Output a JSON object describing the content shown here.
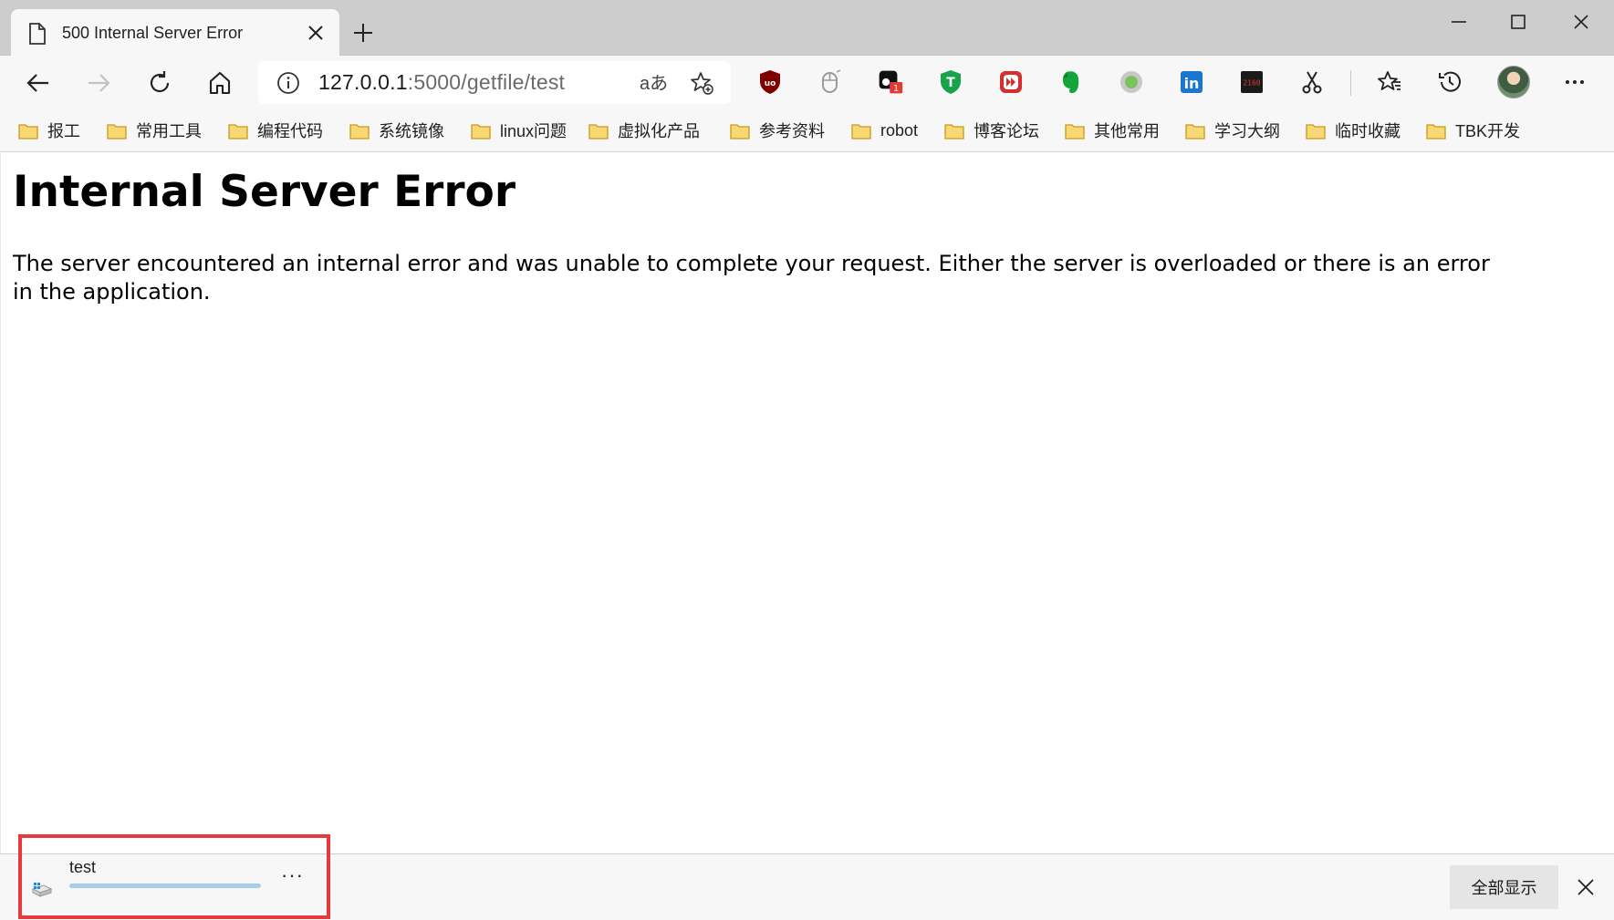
{
  "tab": {
    "title": "500 Internal Server Error",
    "page_icon": "page-icon",
    "close_icon": "close-icon"
  },
  "newtab_icon": "plus-icon",
  "window_controls": [
    "minimize-icon",
    "maximize-icon",
    "close-icon"
  ],
  "toolbar": {
    "back_icon": "back-arrow-icon",
    "forward_icon": "forward-arrow-icon",
    "refresh_icon": "refresh-icon",
    "home_icon": "home-icon",
    "address": {
      "host": "127.0.0.1",
      "path": ":5000/getfile/test",
      "info_icon": "info-icon",
      "translate_label": "aあ",
      "favorite_icon": "add-favorite-icon"
    },
    "extensions": [
      {
        "name": "ublock-icon",
        "label": "uo"
      },
      {
        "name": "mouse-icon",
        "label": ""
      },
      {
        "name": "extension-badge-icon",
        "label": "1"
      },
      {
        "name": "shield-t-icon",
        "label": "T"
      },
      {
        "name": "media-skip-icon",
        "label": ""
      },
      {
        "name": "evernote-icon",
        "label": ""
      },
      {
        "name": "circle-icon",
        "label": ""
      },
      {
        "name": "linkedin-icon",
        "label": "in"
      },
      {
        "name": "counter-icon",
        "label": "2160"
      },
      {
        "name": "scissors-icon",
        "label": ""
      }
    ],
    "favorites_icon": "favorites-icon",
    "history_icon": "history-icon",
    "profile_icon": "avatar",
    "menu_icon": "more-icon"
  },
  "bookmarks": [
    "报工",
    "常用工具",
    "编程代码",
    "系统镜像",
    "linux问题",
    "虚拟化产品",
    "参考资料",
    "robot",
    "博客论坛",
    "其他常用",
    "学习大纲",
    "临时收藏",
    "TBK开发"
  ],
  "page": {
    "title": "Internal Server Error",
    "message": "The server encountered an internal error and was unable to complete your request. Either the server is overloaded or there is an error in the application."
  },
  "downloads": {
    "file_name": "test",
    "progress_fraction": 1.0,
    "more_label": "···",
    "show_all_label": "全部显示",
    "close_icon": "close-icon",
    "colors": {
      "highlight": "#e8393d",
      "progress": "#a9cde8"
    }
  }
}
